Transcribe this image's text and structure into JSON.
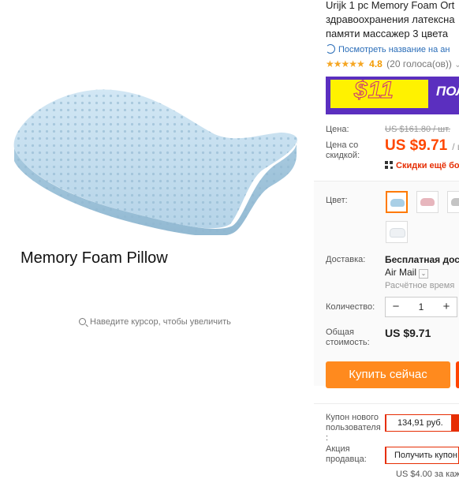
{
  "gallery": {
    "caption": "Memory Foam Pillow",
    "zoom_hint": "Наведите курсор, чтобы увеличить"
  },
  "product": {
    "title_lines": [
      "Urijk 1 pc Memory Foam Ort",
      "здравоохранения латексна",
      "памяти массажер 3 цвета"
    ],
    "translate_link": "Посмотреть название на ан",
    "rating": "4.8",
    "rating_count": "(20 голоса(ов))",
    "stars": "★★★★★"
  },
  "banner": {
    "price_text": "$11",
    "text": "ПОЛ",
    "colors": {
      "background": "#5b2fbf",
      "yellow": "#fff200"
    }
  },
  "price": {
    "label": "Цена:",
    "old": "US $161.80 / шт.",
    "discount_label": "Цена со скидкой:",
    "new": "US $9.71",
    "unit": "/ ш",
    "qr_discount": "Скидки ещё бол"
  },
  "color": {
    "label": "Цвет:",
    "swatches": [
      "blue",
      "pink",
      "gray",
      "white"
    ],
    "selected": "blue"
  },
  "shipping": {
    "label": "Доставка:",
    "name": "Бесплатная доста",
    "method": "Air Mail",
    "estimate": "Расчётное время"
  },
  "quantity": {
    "label": "Количество:",
    "minus": "−",
    "plus": "+",
    "value": "1"
  },
  "total": {
    "label": "Общая стоимость:",
    "value": "US $9.71"
  },
  "buttons": {
    "buy_now": "Купить сейчас"
  },
  "coupon": {
    "new_user_label": "Купон нового пользователя :",
    "new_user_value": "134,91 руб.",
    "seller_label": "Акция продавца:",
    "seller_button": "Получить купон",
    "seller_extra": "US $4.00 за каж"
  },
  "colors": {
    "accent": "#ff4700",
    "buy_button": "#ff8a1e",
    "link": "#2a6db8",
    "star": "#f5a623"
  }
}
